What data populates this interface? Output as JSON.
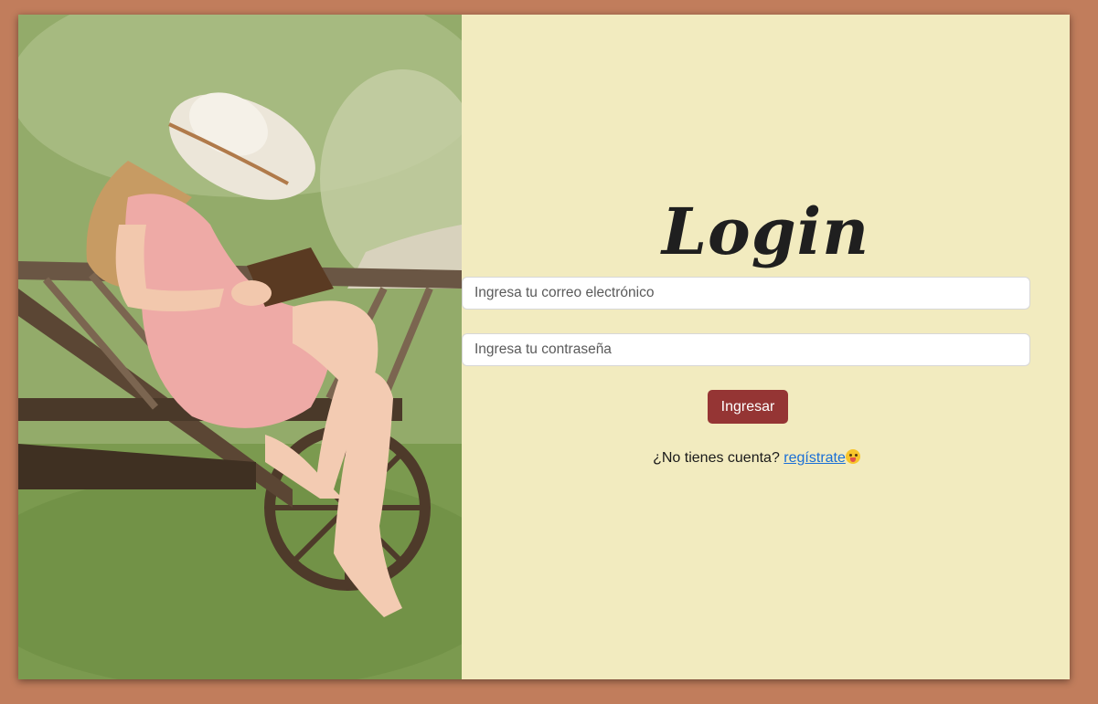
{
  "login": {
    "title": "Login",
    "email_placeholder": "Ingresa tu correo electrónico",
    "password_placeholder": "Ingresa tu contraseña",
    "submit_label": "Ingresar",
    "signup_prompt": "¿No tienes cuenta?",
    "signup_link": "regístrate",
    "signup_icon": "laughing-face-emoji-icon"
  },
  "colors": {
    "page_background": "#c17d5c",
    "panel_background": "#f2ebbf",
    "button": "#953534",
    "link": "#1a6fd6"
  }
}
